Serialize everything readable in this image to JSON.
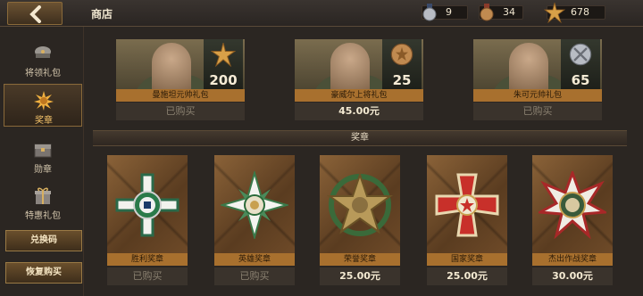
{
  "header": {
    "title": "商店",
    "currencies": [
      {
        "name": "silver-medal-currency",
        "value": "9"
      },
      {
        "name": "bronze-medal-currency",
        "value": "34"
      },
      {
        "name": "star-medal-currency",
        "value": "678"
      }
    ]
  },
  "sidebar": {
    "items": [
      {
        "label": "将领礼包",
        "icon": "general-cap-icon",
        "active": false
      },
      {
        "label": "奖章",
        "icon": "medal-sun-icon",
        "active": true
      },
      {
        "label": "勋章",
        "icon": "chest-icon",
        "active": false
      },
      {
        "label": "特惠礼包",
        "icon": "gift-icon",
        "active": false
      }
    ],
    "buttons": [
      "兑换码",
      "恢复购买"
    ]
  },
  "generals": [
    {
      "name": "曼施坦元帅礼包",
      "badge_number": "200",
      "badge_icon": "star-medal-icon",
      "price": "已购买",
      "bought": true
    },
    {
      "name": "豪威尔上将礼包",
      "badge_number": "25",
      "badge_icon": "bronze-medal-icon",
      "price": "45.00元",
      "bought": false
    },
    {
      "name": "朱可元帅礼包",
      "badge_number": "65",
      "badge_icon": "silver-medal-icon",
      "price": "已购买",
      "bought": true
    }
  ],
  "section": {
    "title": "奖章"
  },
  "medals": [
    {
      "name": "胜利奖章",
      "icon": "victory-cross-icon",
      "price": "已购买",
      "bought": true
    },
    {
      "name": "英雄奖章",
      "icon": "hero-star-cross-icon",
      "price": "已购买",
      "bought": true
    },
    {
      "name": "荣誉奖章",
      "icon": "honor-star-icon",
      "price": "25.00元",
      "bought": false
    },
    {
      "name": "国家奖章",
      "icon": "national-red-cross-icon",
      "price": "25.00元",
      "bought": false
    },
    {
      "name": "杰出作战奖章",
      "icon": "distinguished-cross-icon",
      "price": "30.00元",
      "bought": false
    }
  ],
  "colors": {
    "accent": "#a8702e",
    "active_label": "#f5c36a",
    "background": "#2b2622"
  }
}
